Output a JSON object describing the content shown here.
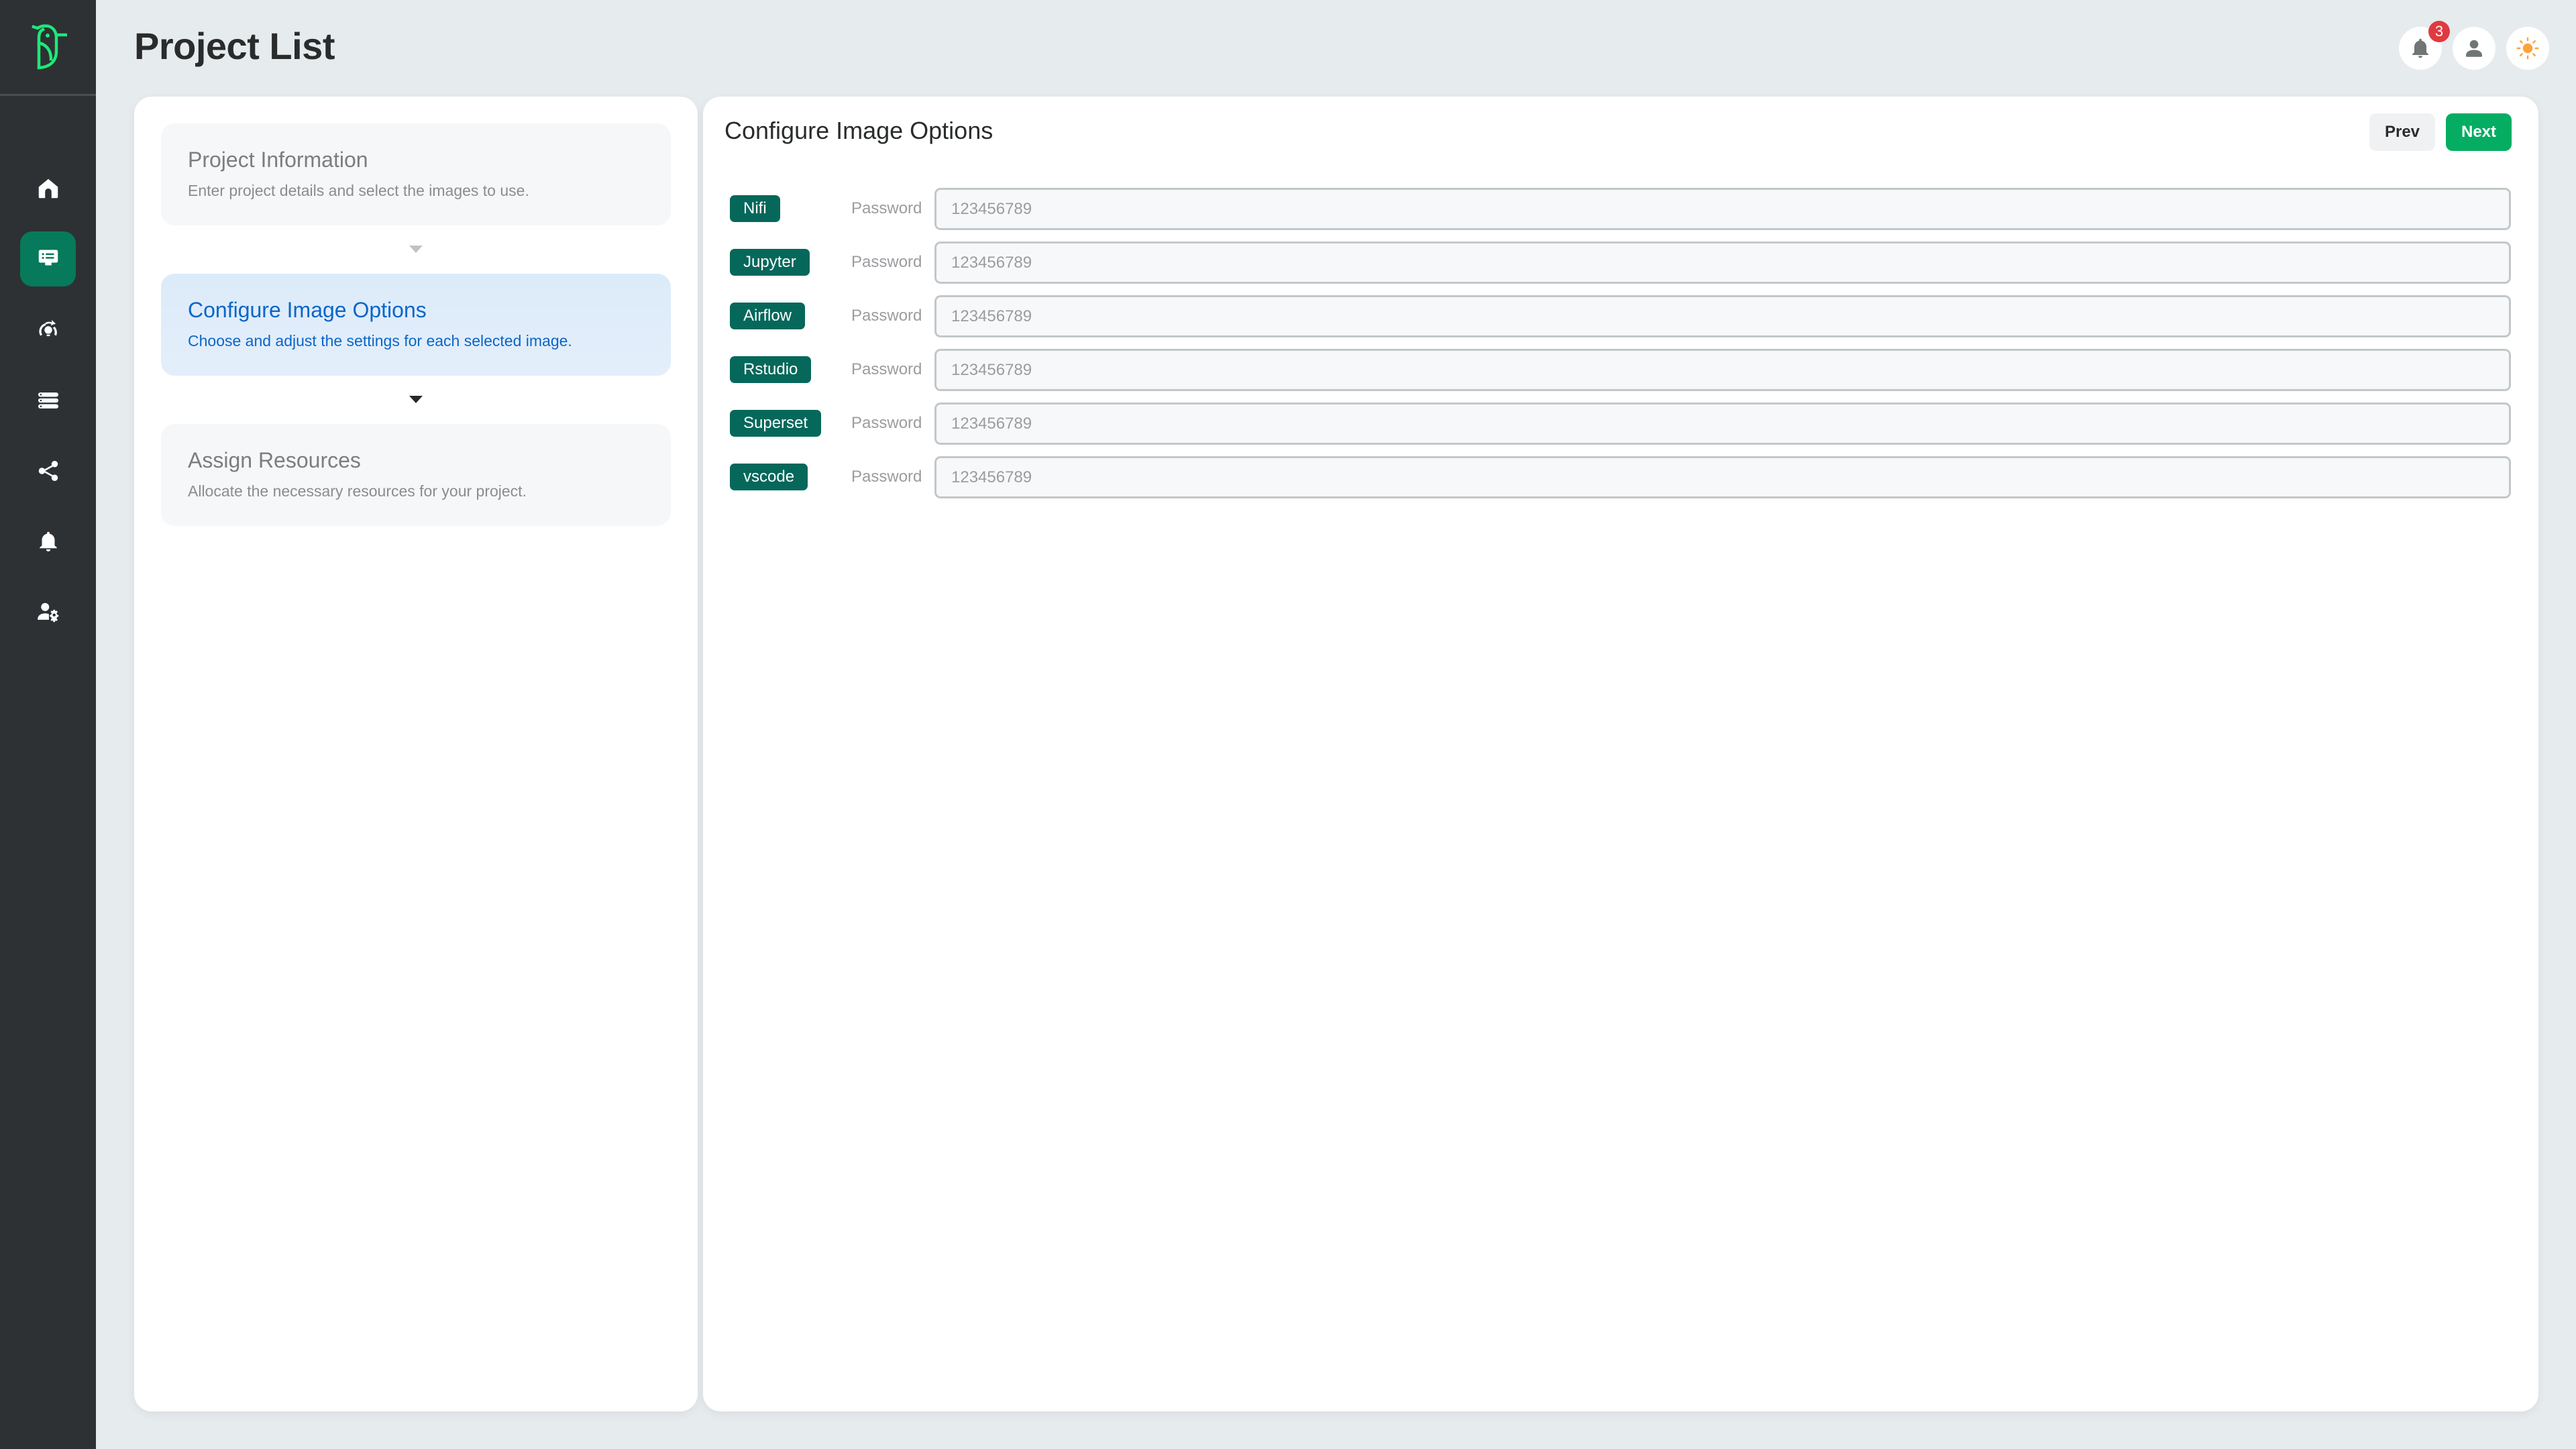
{
  "app": {
    "page_title": "Project List",
    "brand_color": "#1ee87a",
    "accent_color": "#067a5b"
  },
  "sidebar": {
    "logo": "bird-logo",
    "items": [
      {
        "id": "home",
        "icon": "home-icon",
        "active": false
      },
      {
        "id": "projects",
        "icon": "project-list-icon",
        "active": true
      },
      {
        "id": "innovation",
        "icon": "lightbulb-refresh-icon",
        "active": false
      },
      {
        "id": "servers",
        "icon": "server-stack-icon",
        "active": false
      },
      {
        "id": "share",
        "icon": "share-icon",
        "active": false
      },
      {
        "id": "notifications",
        "icon": "bell-icon",
        "active": false
      },
      {
        "id": "user-settings",
        "icon": "user-gear-icon",
        "active": false
      }
    ]
  },
  "header": {
    "notifications_count": "3",
    "icons": [
      "bell-icon",
      "user-icon",
      "sun-icon"
    ]
  },
  "steps": [
    {
      "title": "Project Information",
      "desc": "Enter project details and select the images to use.",
      "state": "done"
    },
    {
      "title": "Configure Image Options",
      "desc": "Choose and adjust the settings for each selected image.",
      "state": "active"
    },
    {
      "title": "Assign Resources",
      "desc": "Allocate the necessary resources for your project.",
      "state": "pending"
    }
  ],
  "main": {
    "title": "Configure Image Options",
    "prev_label": "Prev",
    "next_label": "Next",
    "field_label": "Password",
    "images": [
      {
        "name": "Nifi",
        "password_placeholder": "123456789",
        "password_value": ""
      },
      {
        "name": "Jupyter",
        "password_placeholder": "123456789",
        "password_value": ""
      },
      {
        "name": "Airflow",
        "password_placeholder": "123456789",
        "password_value": ""
      },
      {
        "name": "Rstudio",
        "password_placeholder": "123456789",
        "password_value": ""
      },
      {
        "name": "Superset",
        "password_placeholder": "123456789",
        "password_value": ""
      },
      {
        "name": "vscode",
        "password_placeholder": "123456789",
        "password_value": ""
      }
    ]
  }
}
